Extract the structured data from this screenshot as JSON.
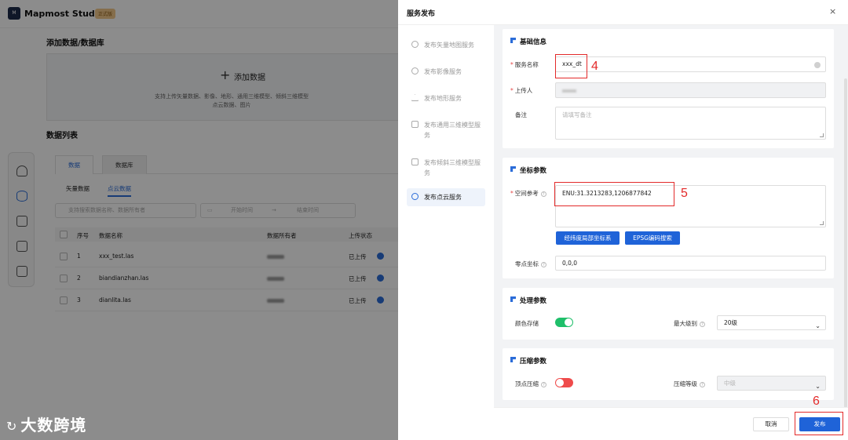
{
  "app": {
    "logo_text": "Mapmost Studio",
    "logo_box_text": "M",
    "edition_badge": "正式版",
    "add_section_title": "添加数据/数据库",
    "add_button_label": "添加数据",
    "add_hint_line1": "支持上传矢量数据、影像、地形、通用三维模型、倾斜三维模型",
    "add_hint_line2": "点云数据、图片",
    "list_title": "数据列表",
    "tabs": [
      "数据",
      "数据库"
    ],
    "subtabs": [
      "矢量数据",
      "点云数据"
    ],
    "search_placeholder": "支持搜索数据名称、数据所有者",
    "date_start_placeholder": "开始时间",
    "date_sep": "→",
    "date_end_placeholder": "结束时间",
    "table_headers": [
      "序号",
      "数据名称",
      "数据所有者",
      "上传状态"
    ],
    "rows": [
      {
        "index": "1",
        "name": "xxx_test.las",
        "status": "已上传"
      },
      {
        "index": "2",
        "name": "biandianzhan.las",
        "status": "已上传"
      },
      {
        "index": "3",
        "name": "dianlita.las",
        "status": "已上传"
      }
    ]
  },
  "watermark": {
    "mark": "↻",
    "text": "大数跨境"
  },
  "drawer": {
    "title": "服务发布",
    "close_glyph": "×",
    "menu": [
      {
        "label": "发布矢量地图服务",
        "active": false
      },
      {
        "label": "发布影像服务",
        "active": false
      },
      {
        "label": "发布地形服务",
        "active": false
      },
      {
        "label": "发布通用三维模型服务",
        "active": false
      },
      {
        "label": "发布倾斜三维模型服务",
        "active": false
      },
      {
        "label": "发布点云服务",
        "active": true
      }
    ],
    "basic": {
      "title": "基础信息",
      "service_name_label": "服务名称",
      "service_name_value": "xxx_dt",
      "uploader_label": "上传人",
      "remark_label": "备注",
      "remark_placeholder": "请填写备注"
    },
    "coord": {
      "title": "坐标参数",
      "spatial_ref_label": "空间参考",
      "spatial_ref_value": "ENU:31.3213283,1206877842",
      "btn_latlon": "经纬度局部坐标系",
      "btn_epsg": "EPSG编码搜索",
      "origin_label": "零点坐标",
      "origin_value": "0,0,0"
    },
    "process": {
      "title": "处理参数",
      "color_store_label": "颜色存储",
      "color_store_on": true,
      "max_level_label": "最大级别",
      "max_level_value": "20级"
    },
    "compress": {
      "title": "压缩参数",
      "vertex_label": "顶点压缩",
      "vertex_on": false,
      "level_label": "压缩等级",
      "level_value": "中级"
    },
    "annotations": {
      "n4": "4",
      "n5": "5",
      "n6": "6"
    },
    "footer": {
      "cancel": "取消",
      "publish": "发布"
    }
  },
  "colors": {
    "accent": "#1f63d8",
    "annotation": "#e32a2a",
    "toggle_on": "#1fbf6a",
    "toggle_off": "#ef4b4b"
  }
}
